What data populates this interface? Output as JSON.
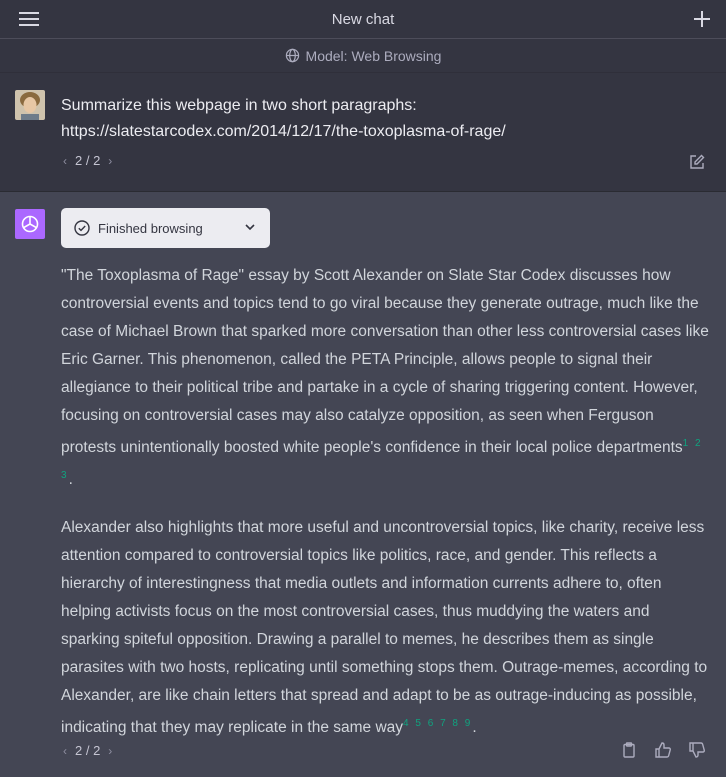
{
  "header": {
    "title": "New chat"
  },
  "model": {
    "label": "Model: Web Browsing"
  },
  "user_message": {
    "line1": "Summarize this webpage in two short paragraphs:",
    "line2": "https://slatestarcodex.com/2014/12/17/the-toxoplasma-of-rage/",
    "pager": "2 / 2"
  },
  "assistant": {
    "browse_label": "Finished browsing",
    "p1": "\"The Toxoplasma of Rage\" essay by Scott Alexander on Slate Star Codex discusses how controversial events and topics tend to go viral because they generate outrage, much like the case of Michael Brown that sparked more conversation than other less controversial cases like Eric Garner. This phenomenon, called the PETA Principle, allows people to signal their allegiance to their political tribe and partake in a cycle of sharing triggering content. However, focusing on controversial cases may also catalyze opposition, as seen when Ferguson protests unintentionally boosted white people's confidence in their local police departments",
    "p1_cites": "1 2 3",
    "p2": "Alexander also highlights that more useful and uncontroversial topics, like charity, receive less attention compared to controversial topics like politics, race, and gender. This reflects a hierarchy of interestingness that media outlets and information currents adhere to, often helping activists focus on the most controversial cases, thus muddying the waters and sparking spiteful opposition. Drawing a parallel to memes, he describes them as single parasites with two hosts, replicating until something stops them. Outrage-memes, according to Alexander, are like chain letters that spread and adapt to be as outrage-inducing as possible, indicating that they may replicate in the same way",
    "p2_cites": "4 5 6 7 8 9",
    "pager": "2 / 2"
  },
  "colors": {
    "accent_cite": "#10a37f",
    "gpt_logo": "#ab68ff"
  }
}
